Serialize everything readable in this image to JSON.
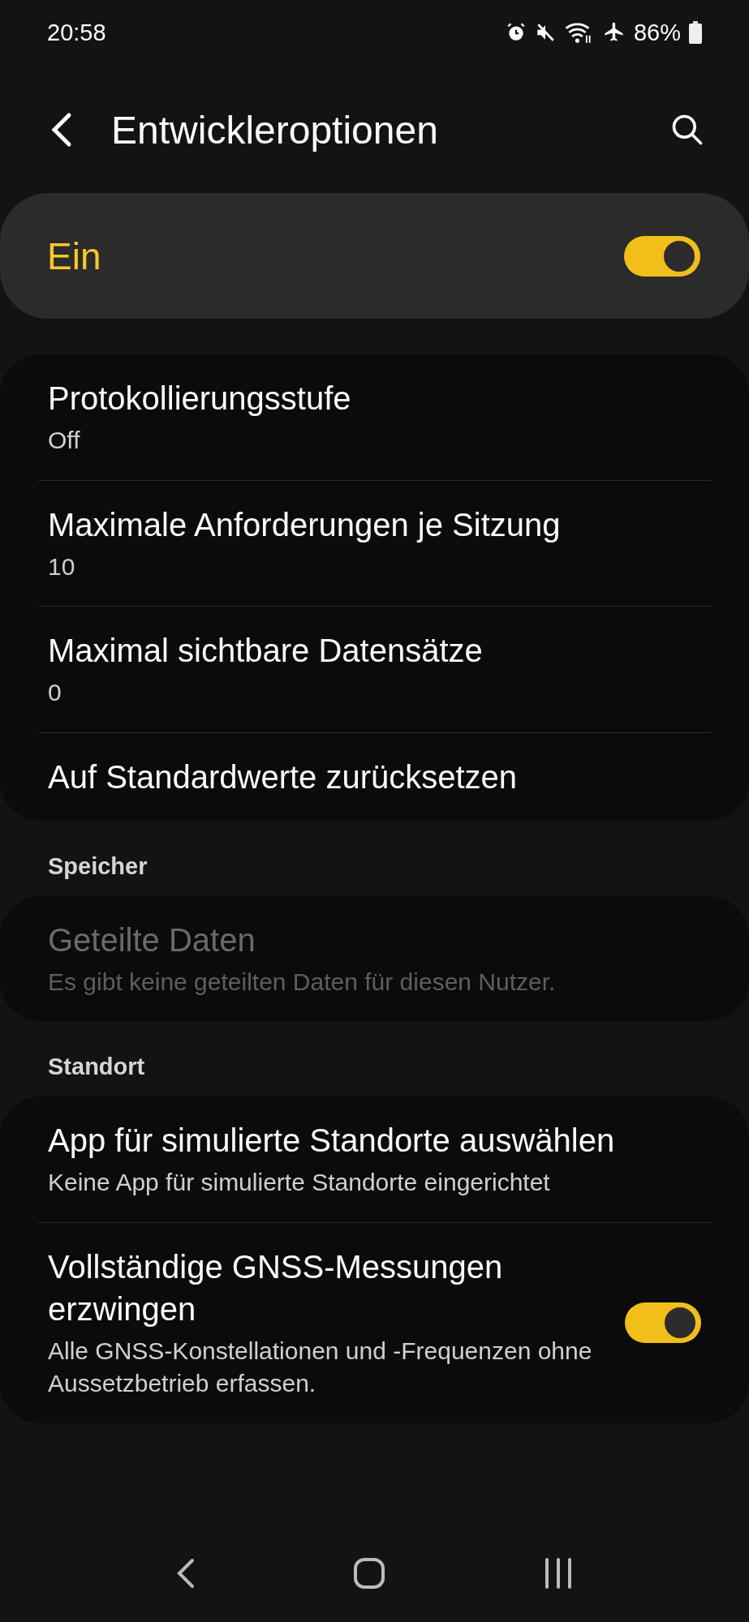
{
  "status_bar": {
    "time": "20:58",
    "battery": "86%"
  },
  "header": {
    "title": "Entwickleroptionen"
  },
  "master": {
    "label": "Ein",
    "on": true
  },
  "sections": [
    {
      "items": [
        {
          "kind": "value",
          "title": "Protokollierungsstufe",
          "subtitle": "Off",
          "disabled": false
        },
        {
          "kind": "value",
          "title": "Maximale Anforderungen je Sitzung",
          "subtitle": "10",
          "disabled": false
        },
        {
          "kind": "value",
          "title": "Maximal sichtbare Datensätze",
          "subtitle": "0",
          "disabled": false
        },
        {
          "kind": "action",
          "title": "Auf Standardwerte zurücksetzen",
          "disabled": false
        }
      ]
    },
    {
      "header": "Speicher",
      "items": [
        {
          "kind": "value",
          "title": "Geteilte Daten",
          "subtitle": "Es gibt keine geteilten Daten für diesen Nutzer.",
          "disabled": true
        }
      ]
    },
    {
      "header": "Standort",
      "items": [
        {
          "kind": "value",
          "title": "App für simulierte Standorte auswählen",
          "subtitle": "Keine App für simulierte Standorte eingerichtet",
          "disabled": false
        },
        {
          "kind": "switch",
          "title": "Vollständige GNSS-Messungen erzwingen",
          "subtitle": "Alle GNSS-Konstellationen und -Frequenzen ohne Aussetzbetrieb erfassen.",
          "on": true,
          "disabled": false
        }
      ]
    }
  ]
}
